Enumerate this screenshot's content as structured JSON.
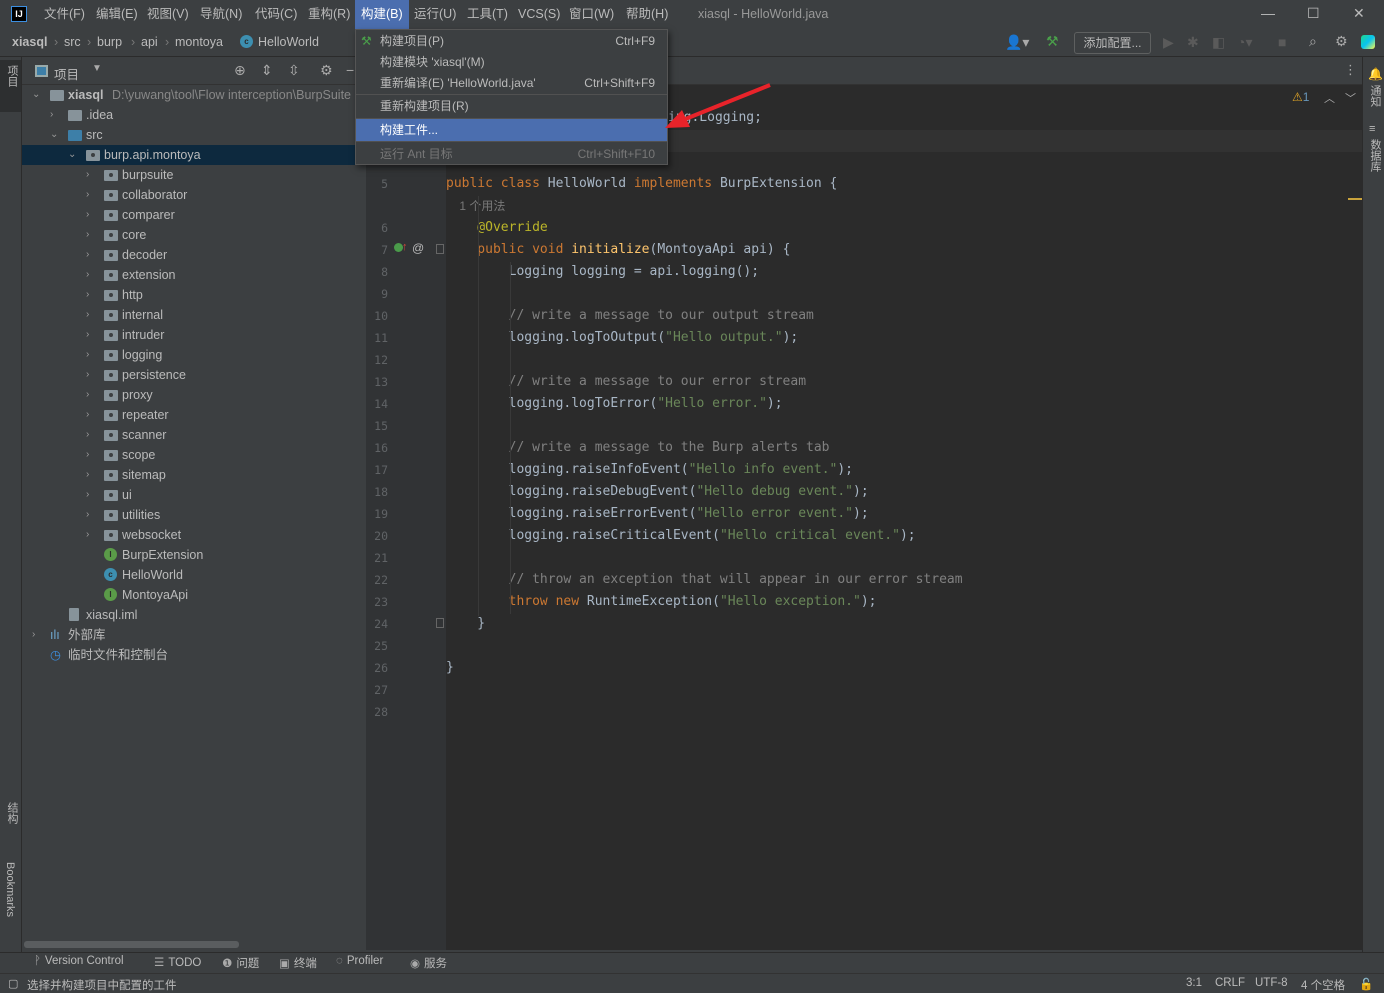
{
  "menubar": {
    "items": [
      "文件(F)",
      "编辑(E)",
      "视图(V)",
      "导航(N)",
      "代码(C)",
      "重构(R)",
      "构建(B)",
      "运行(U)",
      "工具(T)",
      "VCS(S)",
      "窗口(W)",
      "帮助(H)"
    ],
    "active_index": 6,
    "window_title": "xiasql - HelloWorld.java",
    "logo": "IJ"
  },
  "breadcrumb": [
    "xiasql",
    "src",
    "burp",
    "api",
    "montoya",
    "HelloWorld"
  ],
  "toolbar": {
    "add_config": "添加配置...",
    "accent": "#4b6eaf"
  },
  "left_strip": {
    "project": "项目",
    "structure": "结构",
    "bookmarks": "Bookmarks"
  },
  "right_strip": {
    "notifications": "通知",
    "database": "数据库"
  },
  "project_panel": {
    "title": "项目"
  },
  "tree": [
    {
      "label": "xiasql",
      "path": "D:\\yuwang\\tool\\Flow interception\\BurpSuite",
      "level": 0,
      "chev": "v",
      "icon": "module",
      "bold": true
    },
    {
      "label": ".idea",
      "level": 1,
      "chev": ">",
      "icon": "folder"
    },
    {
      "label": "src",
      "level": 1,
      "chev": "v",
      "icon": "folder-blue"
    },
    {
      "label": "burp.api.montoya",
      "level": 2,
      "chev": "v",
      "icon": "package",
      "selected": true
    },
    {
      "label": "burpsuite",
      "level": 3,
      "chev": ">",
      "icon": "package"
    },
    {
      "label": "collaborator",
      "level": 3,
      "chev": ">",
      "icon": "package"
    },
    {
      "label": "comparer",
      "level": 3,
      "chev": ">",
      "icon": "package"
    },
    {
      "label": "core",
      "level": 3,
      "chev": ">",
      "icon": "package"
    },
    {
      "label": "decoder",
      "level": 3,
      "chev": ">",
      "icon": "package"
    },
    {
      "label": "extension",
      "level": 3,
      "chev": ">",
      "icon": "package"
    },
    {
      "label": "http",
      "level": 3,
      "chev": ">",
      "icon": "package"
    },
    {
      "label": "internal",
      "level": 3,
      "chev": ">",
      "icon": "package"
    },
    {
      "label": "intruder",
      "level": 3,
      "chev": ">",
      "icon": "package"
    },
    {
      "label": "logging",
      "level": 3,
      "chev": ">",
      "icon": "package"
    },
    {
      "label": "persistence",
      "level": 3,
      "chev": ">",
      "icon": "package"
    },
    {
      "label": "proxy",
      "level": 3,
      "chev": ">",
      "icon": "package"
    },
    {
      "label": "repeater",
      "level": 3,
      "chev": ">",
      "icon": "package"
    },
    {
      "label": "scanner",
      "level": 3,
      "chev": ">",
      "icon": "package"
    },
    {
      "label": "scope",
      "level": 3,
      "chev": ">",
      "icon": "package"
    },
    {
      "label": "sitemap",
      "level": 3,
      "chev": ">",
      "icon": "package"
    },
    {
      "label": "ui",
      "level": 3,
      "chev": ">",
      "icon": "package"
    },
    {
      "label": "utilities",
      "level": 3,
      "chev": ">",
      "icon": "package"
    },
    {
      "label": "websocket",
      "level": 3,
      "chev": ">",
      "icon": "package"
    },
    {
      "label": "BurpExtension",
      "level": 3,
      "chev": "",
      "icon": "interface"
    },
    {
      "label": "HelloWorld",
      "level": 3,
      "chev": "",
      "icon": "class"
    },
    {
      "label": "MontoyaApi",
      "level": 3,
      "chev": "",
      "icon": "interface"
    },
    {
      "label": "xiasql.iml",
      "level": 1,
      "chev": "",
      "icon": "file"
    },
    {
      "label": "外部库",
      "level": 0,
      "chev": ">",
      "icon": "library"
    },
    {
      "label": "临时文件和控制台",
      "level": 0,
      "chev": "",
      "icon": "scratch"
    }
  ],
  "build_menu": [
    {
      "label": "构建项目(P)",
      "shortcut": "Ctrl+F9",
      "icon": "hammer"
    },
    {
      "label": "构建模块 'xiasql'(M)",
      "shortcut": ""
    },
    {
      "label": "重新编译(E) 'HelloWorld.java'",
      "shortcut": "Ctrl+Shift+F9"
    },
    {
      "label": "重新构建项目(R)",
      "shortcut": ""
    },
    {
      "label": "构建工件...",
      "shortcut": "",
      "highlighted": true
    },
    {
      "label": "运行 Ant 目标",
      "shortcut": "Ctrl+Shift+F10",
      "disabled": true
    }
  ],
  "editor": {
    "inspection": {
      "warnings": "1"
    },
    "partial_line": "ing.Logging;",
    "lines": [
      {
        "n": "5",
        "tokens": [
          [
            "kw",
            "public class "
          ],
          [
            "",
            "HelloWorld "
          ],
          [
            "kw",
            "implements "
          ],
          [
            "",
            "BurpExtension {"
          ]
        ]
      },
      {
        "n": "",
        "hint": "1 个用法"
      },
      {
        "n": "6",
        "tokens": [
          [
            "an",
            "    @Override"
          ]
        ]
      },
      {
        "n": "7",
        "tokens": [
          [
            "kw",
            "    public void "
          ],
          [
            "md",
            "initialize"
          ],
          [
            "",
            "(MontoyaApi api) {"
          ]
        ]
      },
      {
        "n": "8",
        "tokens": [
          [
            "",
            "        Logging logging = api.logging();"
          ]
        ]
      },
      {
        "n": "9",
        "tokens": []
      },
      {
        "n": "10",
        "tokens": [
          [
            "cm",
            "        // write a message to our output stream"
          ]
        ]
      },
      {
        "n": "11",
        "tokens": [
          [
            "",
            "        logging.logToOutput("
          ],
          [
            "str",
            "\"Hello output.\""
          ],
          [
            "",
            ");"
          ]
        ]
      },
      {
        "n": "12",
        "tokens": []
      },
      {
        "n": "13",
        "tokens": [
          [
            "cm",
            "        // write a message to our error stream"
          ]
        ]
      },
      {
        "n": "14",
        "tokens": [
          [
            "",
            "        logging.logToError("
          ],
          [
            "str",
            "\"Hello error.\""
          ],
          [
            "",
            ");"
          ]
        ]
      },
      {
        "n": "15",
        "tokens": []
      },
      {
        "n": "16",
        "tokens": [
          [
            "cm",
            "        // write a message to the Burp alerts tab"
          ]
        ]
      },
      {
        "n": "17",
        "tokens": [
          [
            "",
            "        logging.raiseInfoEvent("
          ],
          [
            "str",
            "\"Hello info event.\""
          ],
          [
            "",
            ");"
          ]
        ]
      },
      {
        "n": "18",
        "tokens": [
          [
            "",
            "        logging.raiseDebugEvent("
          ],
          [
            "str",
            "\"Hello debug event.\""
          ],
          [
            "",
            ");"
          ]
        ]
      },
      {
        "n": "19",
        "tokens": [
          [
            "",
            "        logging.raiseErrorEvent("
          ],
          [
            "str",
            "\"Hello error event.\""
          ],
          [
            "",
            ");"
          ]
        ]
      },
      {
        "n": "20",
        "tokens": [
          [
            "",
            "        logging.raiseCriticalEvent("
          ],
          [
            "str",
            "\"Hello critical event.\""
          ],
          [
            "",
            ");"
          ]
        ]
      },
      {
        "n": "21",
        "tokens": []
      },
      {
        "n": "22",
        "tokens": [
          [
            "cm",
            "        // throw an exception that will appear in our error stream"
          ]
        ]
      },
      {
        "n": "23",
        "tokens": [
          [
            "kw",
            "        throw new "
          ],
          [
            "",
            "RuntimeException("
          ],
          [
            "str",
            "\"Hello exception.\""
          ],
          [
            "",
            ");"
          ]
        ]
      },
      {
        "n": "24",
        "tokens": [
          [
            "",
            "    }"
          ]
        ]
      },
      {
        "n": "25",
        "tokens": []
      },
      {
        "n": "26",
        "tokens": [
          [
            "",
            "}"
          ]
        ]
      },
      {
        "n": "27",
        "tokens": []
      },
      {
        "n": "28",
        "tokens": []
      }
    ],
    "colors": {
      "keyword": "#cc7832",
      "string": "#6a8759",
      "comment": "#808080",
      "annotation": "#bbb529",
      "method": "#ffc66d",
      "text": "#a9b7c6"
    }
  },
  "bottom_tools": [
    "Version Control",
    "TODO",
    "问题",
    "终端",
    "Profiler",
    "服务"
  ],
  "status": {
    "message": "选择并构建项目中配置的工件",
    "position": "3:1",
    "line_sep": "CRLF",
    "encoding": "UTF-8",
    "indent": "4 个空格"
  }
}
